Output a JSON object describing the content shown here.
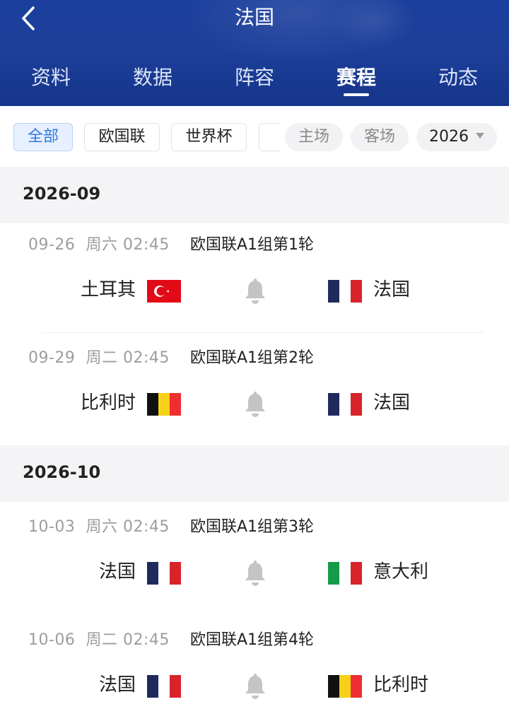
{
  "header": {
    "title": "法国",
    "back_icon": "chevron-left-icon",
    "tabs": [
      {
        "label": "资料",
        "active": false
      },
      {
        "label": "数据",
        "active": false
      },
      {
        "label": "阵容",
        "active": false
      },
      {
        "label": "赛程",
        "active": true
      },
      {
        "label": "动态",
        "active": false
      }
    ]
  },
  "filters": {
    "competitions": [
      {
        "label": "全部",
        "active": true
      },
      {
        "label": "欧国联",
        "active": false
      },
      {
        "label": "世界杯",
        "active": false
      },
      {
        "label": "",
        "active": false
      }
    ],
    "home_label": "主场",
    "away_label": "客场",
    "year": "2026"
  },
  "colors": {
    "header_blue": "#1c3f9a",
    "active_chip_text": "#2f78e0",
    "bell": "#c4c4c4"
  },
  "months": [
    {
      "label": "2026-09",
      "matches": [
        {
          "date": "09-26",
          "weekday": "周六",
          "time": "02:45",
          "round": "欧国联A1组第1轮",
          "home": "土耳其",
          "home_flag": "turkey",
          "away": "法国",
          "away_flag": "france",
          "notify_icon": "bell-icon"
        },
        {
          "date": "09-29",
          "weekday": "周二",
          "time": "02:45",
          "round": "欧国联A1组第2轮",
          "home": "比利时",
          "home_flag": "belgium",
          "away": "法国",
          "away_flag": "france",
          "notify_icon": "bell-icon"
        }
      ]
    },
    {
      "label": "2026-10",
      "matches": [
        {
          "date": "10-03",
          "weekday": "周六",
          "time": "02:45",
          "round": "欧国联A1组第3轮",
          "home": "法国",
          "home_flag": "france",
          "away": "意大利",
          "away_flag": "italy",
          "notify_icon": "bell-icon"
        },
        {
          "date": "10-06",
          "weekday": "周二",
          "time": "02:45",
          "round": "欧国联A1组第4轮",
          "home": "法国",
          "home_flag": "france",
          "away": "比利时",
          "away_flag": "belgium",
          "notify_icon": "bell-icon"
        }
      ]
    }
  ]
}
